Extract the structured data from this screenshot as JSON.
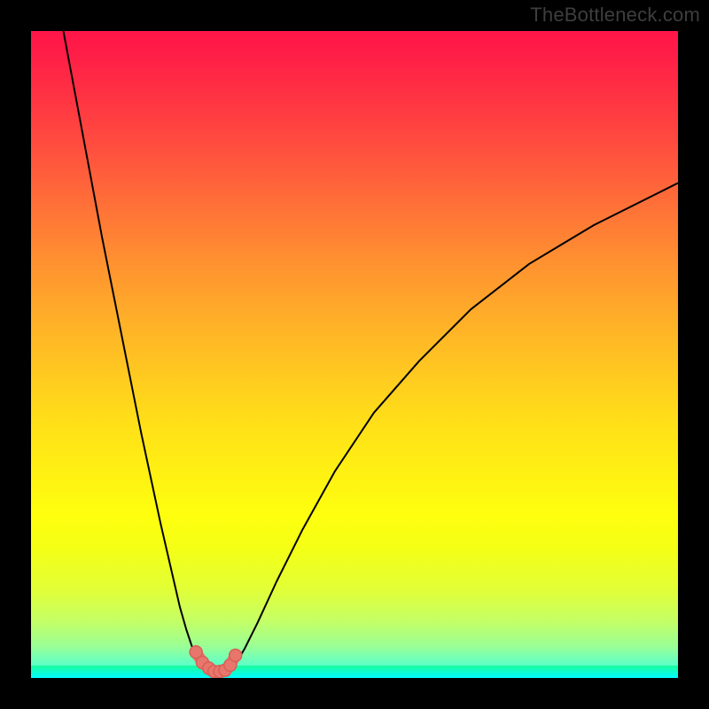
{
  "watermark": "TheBottleneck.com",
  "colors": {
    "frame": "#000000",
    "curve": "#000000",
    "marker": "#e8766c",
    "gradient_top": "#ff1548",
    "gradient_mid": "#fff013",
    "gradient_bottom": "#03fbff"
  },
  "chart_data": {
    "type": "line",
    "title": "",
    "xlabel": "",
    "ylabel": "",
    "xlim": [
      0,
      100
    ],
    "ylim": [
      0,
      100
    ],
    "grid": false,
    "legend": false,
    "annotations": [],
    "series": [
      {
        "name": "left-branch",
        "x": [
          5,
          8,
          11,
          14,
          17,
          20,
          23,
          24,
          25,
          26,
          27
        ],
        "y": [
          100,
          84,
          68,
          53,
          38,
          24,
          11,
          7.5,
          4.5,
          2.5,
          1.6
        ]
      },
      {
        "name": "right-branch",
        "x": [
          31,
          32,
          33,
          35,
          38,
          42,
          47,
          53,
          60,
          68,
          77,
          87,
          97,
          100
        ],
        "y": [
          1.6,
          2.8,
          4.5,
          8.5,
          15,
          23,
          32,
          41,
          49,
          57,
          64,
          70,
          75,
          76.5
        ]
      },
      {
        "name": "markers",
        "x": [
          25.5,
          26.5,
          27.5,
          28.3,
          29.2,
          30.0,
          30.8,
          31.6
        ],
        "y": [
          4.0,
          2.4,
          1.5,
          1.0,
          1.0,
          1.2,
          2.0,
          3.5
        ]
      }
    ]
  }
}
